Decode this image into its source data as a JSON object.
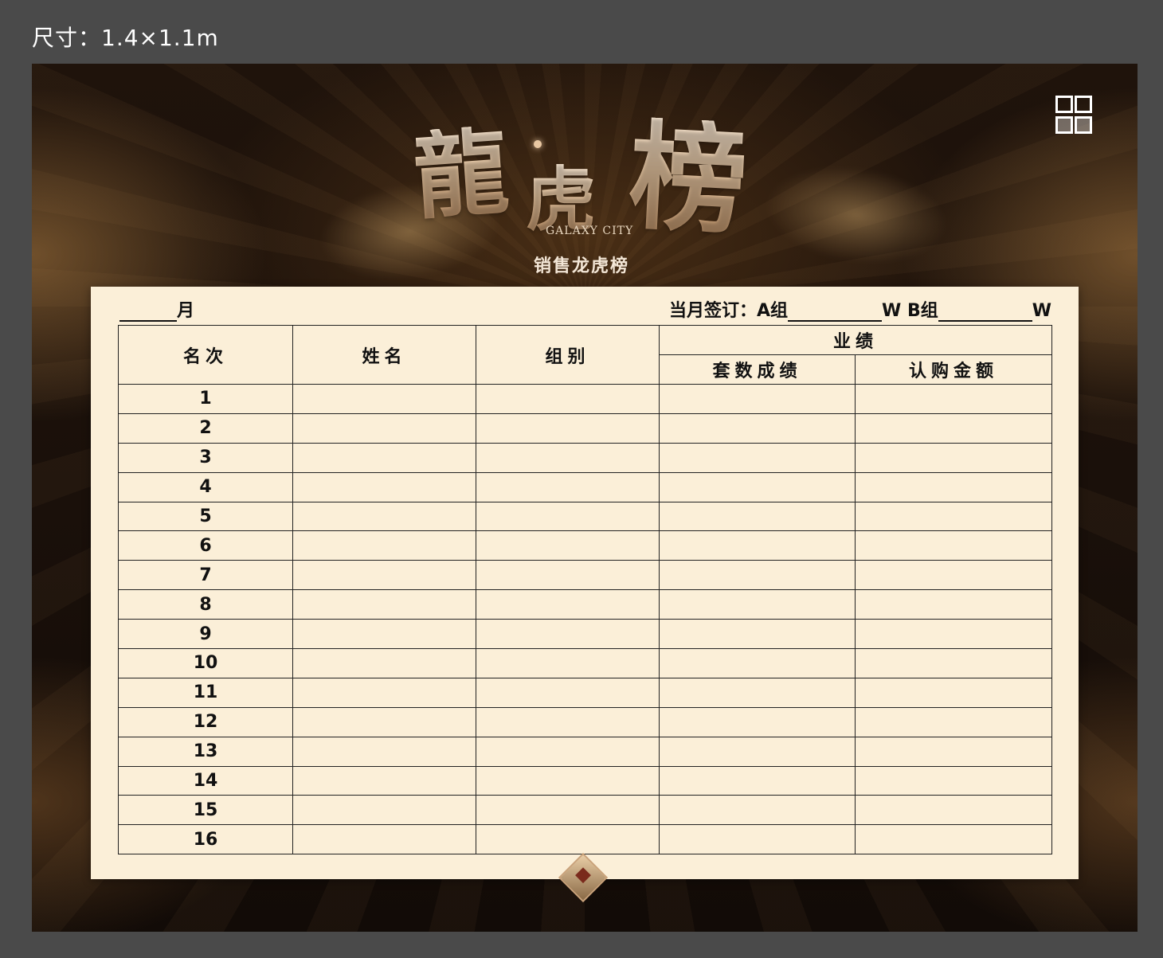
{
  "size_label": "尺寸：1.4×1.1m",
  "poster": {
    "title_chars": [
      "龍",
      "虎",
      "榜"
    ],
    "brand_en": "GALAXY CITY",
    "subtitle": "销售龙虎榜",
    "logo": {
      "cn": "",
      "en": ""
    }
  },
  "board": {
    "month_suffix": "月",
    "sign_label": "当月签订：A组",
    "sign_w1": "W",
    "sign_b": " B组",
    "sign_w2": "W",
    "headers": {
      "rank": "名次",
      "name": "姓名",
      "group": "组别",
      "performance": "业绩",
      "sets": "套数成绩",
      "amount": "认购金额"
    },
    "ranks": [
      "1",
      "2",
      "3",
      "4",
      "5",
      "6",
      "7",
      "8",
      "9",
      "10",
      "11",
      "12",
      "13",
      "14",
      "15",
      "16"
    ]
  },
  "colors": {
    "board_bg": "#fbefd8",
    "title_gold": "#e8c7a2",
    "poster_bg": "#1a100a",
    "outer_bg": "#4a4a4a"
  }
}
